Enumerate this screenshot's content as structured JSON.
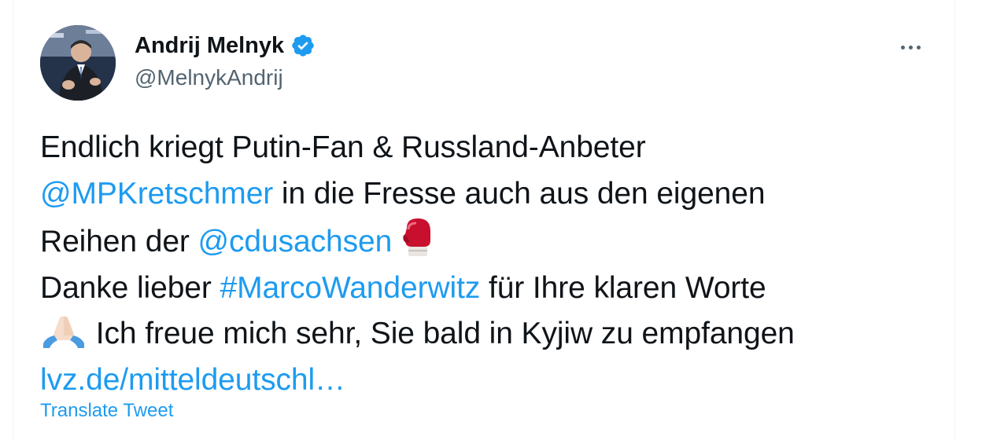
{
  "author": {
    "display_name": "Andrij Melnyk",
    "handle": "@MelnykAndrij",
    "verified": true,
    "avatar_icon": "profile-photo"
  },
  "menu": {
    "icon": "more-horizontal-icon"
  },
  "tweet": {
    "line1": "Endlich kriegt Putin-Fan & Russland-Anbeter",
    "mention1": "@MPKretschmer",
    "line2_text": " in die Fresse auch aus den eigenen",
    "line3_prefix": "Reihen der ",
    "mention2": "@cdusachsen",
    "emoji_boxing": "boxing-glove-emoji",
    "line4_prefix": "Danke lieber ",
    "hashtag": "#MarcoWanderwitz",
    "line4_suffix": " für Ihre klaren Worte",
    "emoji_pray": "folded-hands-emoji",
    "line5_text": " Ich freue mich sehr, Sie bald in Kyjiw zu empfangen",
    "link": "lvz.de/mitteldeutschl…"
  },
  "actions": {
    "translate_label": "Translate Tweet"
  },
  "colors": {
    "link": "#1d9bf0",
    "text": "#0f1419",
    "secondary": "#536471",
    "verified": "#1d9bf0"
  }
}
